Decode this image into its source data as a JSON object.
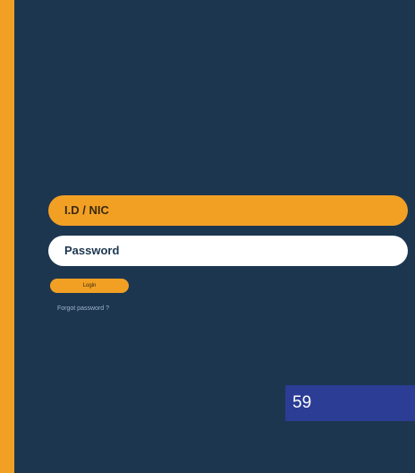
{
  "login_form": {
    "id_placeholder": "I.D / NIC",
    "password_placeholder": "Password",
    "login_label": "Login",
    "forgot_password_label": "Forgot password ?"
  },
  "page": {
    "number": "59"
  },
  "colors": {
    "background": "#1d3650",
    "accent": "#f2a024",
    "page_box": "#2b3d95"
  }
}
